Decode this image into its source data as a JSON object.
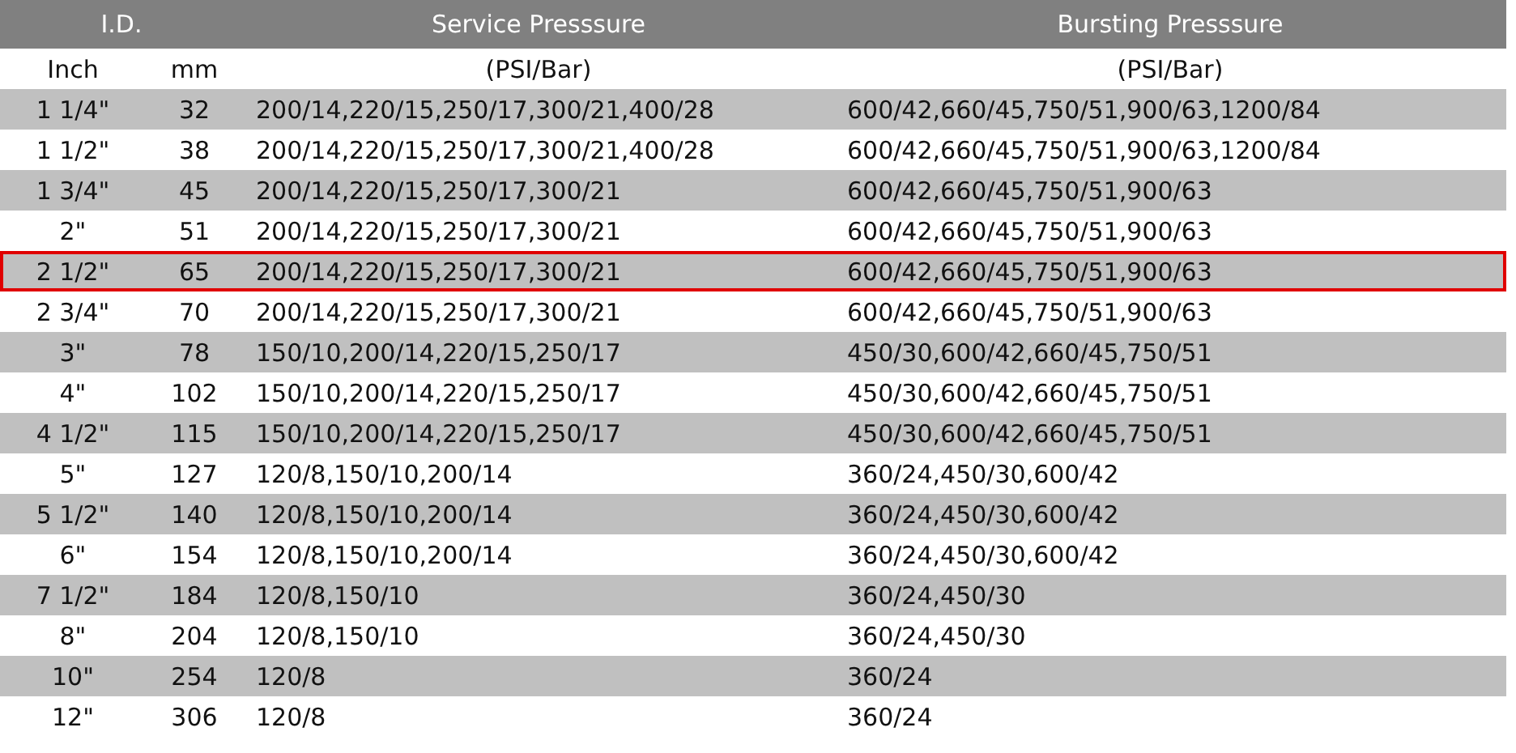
{
  "header": {
    "id": "I.D.",
    "service": "Service Presssure",
    "bursting": "Bursting Presssure"
  },
  "subheader": {
    "inch": "Inch",
    "mm": "mm",
    "service": "(PSI/Bar)",
    "bursting": "(PSI/Bar)"
  },
  "rows": [
    {
      "inch": "1 1/4\"",
      "mm": "32",
      "service": "200/14,220/15,250/17,300/21,400/28",
      "bursting": "600/42,660/45,750/51,900/63,1200/84",
      "selected": false
    },
    {
      "inch": "1 1/2\"",
      "mm": "38",
      "service": "200/14,220/15,250/17,300/21,400/28",
      "bursting": "600/42,660/45,750/51,900/63,1200/84",
      "selected": false
    },
    {
      "inch": "1 3/4\"",
      "mm": "45",
      "service": "200/14,220/15,250/17,300/21",
      "bursting": "600/42,660/45,750/51,900/63",
      "selected": false
    },
    {
      "inch": "2\"",
      "mm": "51",
      "service": "200/14,220/15,250/17,300/21",
      "bursting": "600/42,660/45,750/51,900/63",
      "selected": false
    },
    {
      "inch": "2 1/2\"",
      "mm": "65",
      "service": "200/14,220/15,250/17,300/21",
      "bursting": "600/42,660/45,750/51,900/63",
      "selected": true
    },
    {
      "inch": "2 3/4\"",
      "mm": "70",
      "service": "200/14,220/15,250/17,300/21",
      "bursting": "600/42,660/45,750/51,900/63",
      "selected": false
    },
    {
      "inch": "3\"",
      "mm": "78",
      "service": "150/10,200/14,220/15,250/17",
      "bursting": "450/30,600/42,660/45,750/51",
      "selected": false
    },
    {
      "inch": "4\"",
      "mm": "102",
      "service": "150/10,200/14,220/15,250/17",
      "bursting": "450/30,600/42,660/45,750/51",
      "selected": false
    },
    {
      "inch": "4 1/2\"",
      "mm": "115",
      "service": "150/10,200/14,220/15,250/17",
      "bursting": "450/30,600/42,660/45,750/51",
      "selected": false
    },
    {
      "inch": "5\"",
      "mm": "127",
      "service": "120/8,150/10,200/14",
      "bursting": "360/24,450/30,600/42",
      "selected": false
    },
    {
      "inch": "5 1/2\"",
      "mm": "140",
      "service": "120/8,150/10,200/14",
      "bursting": "360/24,450/30,600/42",
      "selected": false
    },
    {
      "inch": "6\"",
      "mm": "154",
      "service": "120/8,150/10,200/14",
      "bursting": "360/24,450/30,600/42",
      "selected": false
    },
    {
      "inch": "7 1/2\"",
      "mm": "184",
      "service": "120/8,150/10",
      "bursting": "360/24,450/30",
      "selected": false
    },
    {
      "inch": "8\"",
      "mm": "204",
      "service": "120/8,150/10",
      "bursting": "360/24,450/30",
      "selected": false
    },
    {
      "inch": "10\"",
      "mm": "254",
      "service": "120/8",
      "bursting": "360/24",
      "selected": false
    },
    {
      "inch": "12\"",
      "mm": "306",
      "service": "120/8",
      "bursting": "360/24",
      "selected": false
    }
  ]
}
